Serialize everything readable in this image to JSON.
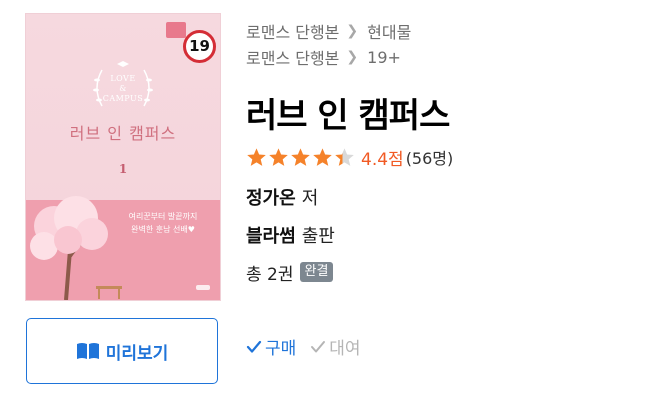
{
  "breadcrumbs": [
    {
      "category": "로맨스 단행본",
      "sub": "현대물"
    },
    {
      "category": "로맨스 단행본",
      "sub": "19+"
    }
  ],
  "title": "러브 인 캠퍼스",
  "rating": {
    "stars": 4.4,
    "score_text": "4.4점",
    "count_text": "(56명)",
    "star_color": "#f5822a"
  },
  "author": {
    "name": "정가온",
    "role": "저"
  },
  "publisher": {
    "name": "블라썸",
    "role": "출판"
  },
  "volumes": {
    "text": "총 2권",
    "badge": "완결"
  },
  "purchase": {
    "buy_label": "구매",
    "rent_label": "대여"
  },
  "preview_button": {
    "label": "미리보기"
  },
  "cover": {
    "age_badge": "19",
    "emblem_line1": "LOVE",
    "emblem_line2": "&",
    "emblem_line3": "CAMPUS",
    "cover_title": "러브 인 캠퍼스",
    "volume_mark": "1",
    "blurb_line1": "여리꾼부터 발끝까지",
    "blurb_line2": "완벽한 훈남 선배♥"
  },
  "colors": {
    "accent": "#1f74d9",
    "rating": "#f15a24",
    "badge_bg": "#7d8790"
  }
}
